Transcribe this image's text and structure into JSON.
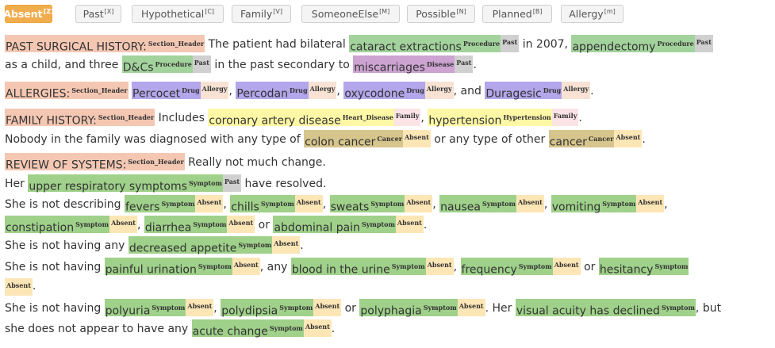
{
  "filters": [
    {
      "label": "Absent",
      "key": "Z",
      "active": true
    },
    {
      "label": "Past",
      "key": "X",
      "active": false
    },
    {
      "label": "Hypothetical",
      "key": "C",
      "active": false
    },
    {
      "label": "Family",
      "key": "V",
      "active": false
    },
    {
      "label": "SomeoneElse",
      "key": "M",
      "active": false
    },
    {
      "label": "Possible",
      "key": "N",
      "active": false
    },
    {
      "label": "Planned",
      "key": "B",
      "active": false
    },
    {
      "label": "Allergy",
      "key": "m",
      "active": false
    }
  ],
  "colors": {
    "Section_Header": "#f4c7b3",
    "Procedure": "#a3d39c",
    "Disease": "#cca3d1",
    "Drug": "#b3a6ea",
    "Heart_Disease": "#fef8a6",
    "Cancer": "#d6c58c",
    "Symptom": "#9fd18a",
    "Past": "#d0d0d0",
    "Allergy": "#f7e2d4",
    "Family": "#fbe3e6",
    "Absent": "#fde6b6"
  },
  "document": [
    [
      {
        "text": "PAST SURGICAL HISTORY:",
        "label": "Section_Header"
      },
      {
        "text": " The patient had bilateral "
      },
      {
        "text": "cataract extractions",
        "label": "Procedure",
        "assertion": "Past"
      },
      {
        "text": " in 2007, "
      },
      {
        "text": "appendectomy",
        "label": "Procedure",
        "assertion": "Past"
      }
    ],
    [
      {
        "text": "as a child, and three "
      },
      {
        "text": "D&Cs",
        "label": "Procedure",
        "assertion": "Past"
      },
      {
        "text": " in the past secondary to "
      },
      {
        "text": "miscarriages",
        "label": "Disease",
        "assertion": "Past"
      },
      {
        "text": "."
      }
    ],
    [
      {
        "text": "ALLERGIES:",
        "label": "Section_Header"
      },
      {
        "text": " "
      },
      {
        "text": "Percocet",
        "label": "Drug",
        "assertion": "Allergy"
      },
      {
        "text": ", "
      },
      {
        "text": "Percodan",
        "label": "Drug",
        "assertion": "Allergy"
      },
      {
        "text": ", "
      },
      {
        "text": "oxycodone",
        "label": "Drug",
        "assertion": "Allergy"
      },
      {
        "text": ", and "
      },
      {
        "text": "Duragesic",
        "label": "Drug",
        "assertion": "Allergy"
      },
      {
        "text": "."
      }
    ],
    [
      {
        "text": "FAMILY HISTORY:",
        "label": "Section_Header"
      },
      {
        "text": " Includes "
      },
      {
        "text": "coronary artery disease",
        "label": "Heart_Disease",
        "assertion": "Family"
      },
      {
        "text": ", "
      },
      {
        "text": "hypertension",
        "label": "Hypertension",
        "assertion": "Family"
      },
      {
        "text": "."
      }
    ],
    [
      {
        "text": "Nobody in the family was diagnosed with any type of "
      },
      {
        "text": "colon cancer",
        "label": "Cancer",
        "assertion": "Absent"
      },
      {
        "text": " or any type of other "
      },
      {
        "text": "cancer",
        "label": "Cancer",
        "assertion": "Absent"
      },
      {
        "text": "."
      }
    ],
    [
      {
        "text": "REVIEW OF SYSTEMS:",
        "label": "Section_Header"
      },
      {
        "text": " Really not much change."
      }
    ],
    [
      {
        "text": "Her "
      },
      {
        "text": "upper respiratory symptoms",
        "label": "Symptom",
        "assertion": "Past"
      },
      {
        "text": " have resolved."
      }
    ],
    [
      {
        "text": "She is not describing "
      },
      {
        "text": "fevers",
        "label": "Symptom",
        "assertion": "Absent"
      },
      {
        "text": ", "
      },
      {
        "text": "chills",
        "label": "Symptom",
        "assertion": "Absent"
      },
      {
        "text": ", "
      },
      {
        "text": "sweats",
        "label": "Symptom",
        "assertion": "Absent"
      },
      {
        "text": ", "
      },
      {
        "text": "nausea",
        "label": "Symptom",
        "assertion": "Absent"
      },
      {
        "text": ", "
      },
      {
        "text": "vomiting",
        "label": "Symptom",
        "assertion": "Absent"
      },
      {
        "text": ","
      }
    ],
    [
      {
        "text": "constipation",
        "label": "Symptom",
        "assertion": "Absent"
      },
      {
        "text": ", "
      },
      {
        "text": "diarrhea",
        "label": "Symptom",
        "assertion": "Absent"
      },
      {
        "text": " or "
      },
      {
        "text": "abdominal pain",
        "label": "Symptom",
        "assertion": "Absent"
      },
      {
        "text": "."
      }
    ],
    [
      {
        "text": "She is not having any "
      },
      {
        "text": "decreased appetite",
        "label": "Symptom",
        "assertion": "Absent"
      },
      {
        "text": "."
      }
    ],
    [
      {
        "text": "She is not having "
      },
      {
        "text": "painful urination",
        "label": "Symptom",
        "assertion": "Absent"
      },
      {
        "text": ", any "
      },
      {
        "text": "blood in the urine",
        "label": "Symptom",
        "assertion": "Absent"
      },
      {
        "text": ", "
      },
      {
        "text": "frequency",
        "label": "Symptom",
        "assertion": "Absent"
      },
      {
        "text": " or "
      },
      {
        "text": "hesitancy",
        "label": "Symptom",
        "assertion": "Absent",
        "wrap": true
      }
    ],
    [
      {
        "text": "She is not having "
      },
      {
        "text": "polyuria",
        "label": "Symptom",
        "assertion": "Absent"
      },
      {
        "text": ", "
      },
      {
        "text": "polydipsia",
        "label": "Symptom",
        "assertion": "Absent"
      },
      {
        "text": " or "
      },
      {
        "text": "polyphagia",
        "label": "Symptom",
        "assertion": "Absent"
      },
      {
        "text": ". Her "
      },
      {
        "text": "visual acuity has declined",
        "label": "Symptom"
      },
      {
        "text": ", but"
      }
    ],
    [
      {
        "text": "she does not appear to have any "
      },
      {
        "text": "acute change",
        "label": "Symptom",
        "assertion": "Absent"
      },
      {
        "text": "."
      }
    ]
  ]
}
